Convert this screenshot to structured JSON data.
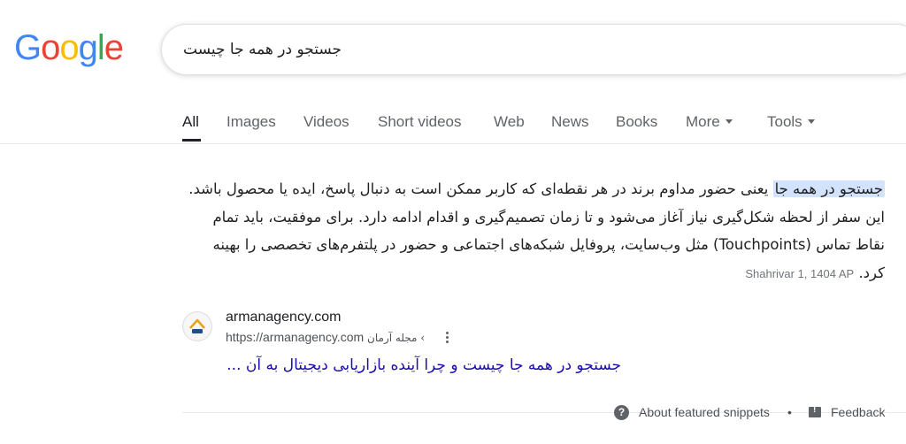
{
  "logo": {
    "letters": [
      "G",
      "o",
      "o",
      "g",
      "l",
      "e"
    ]
  },
  "search": {
    "query": "جستجو در همه جا چیست"
  },
  "tabs": [
    {
      "label": "All",
      "active": true
    },
    {
      "label": "Images"
    },
    {
      "label": "Videos"
    },
    {
      "label": "Short videos"
    },
    {
      "label": "Web"
    },
    {
      "label": "News"
    },
    {
      "label": "Books"
    },
    {
      "label": "More"
    },
    {
      "label": "Tools"
    }
  ],
  "snippet": {
    "highlight": "جستجو در همه جا",
    "text": "یعنی حضور مداوم برند در هر نقطه‌ای که کاربر ممکن است به دنبال پاسخ، ایده یا محصول باشد. این سفر از لحظه شکل‌گیری نیاز آغاز می‌شود و تا زمان تصمیم‌گیری و اقدام ادامه دارد. برای موفقیت، باید تمام نقاط تماس (Touchpoints) مثل وب‌سایت، پروفایل شبکه‌های اجتماعی و حضور در پلتفرم‌های تخصصی را بهینه کرد.",
    "date": "Shahrivar 1, 1404 AP"
  },
  "result": {
    "site_name": "armanagency.com",
    "url": "https://armanagency.com",
    "breadcrumb": "› مجله آرمان",
    "title": "جستجو در همه جا چیست و چرا آینده بازاریابی دیجیتال به آن ...",
    "favicon": "arman-logo-icon"
  },
  "footer": {
    "about": "About featured snippets",
    "separator": "•",
    "feedback": "Feedback"
  },
  "colors": {
    "link": "#1a0dab",
    "highlight": "#d3e3fd"
  }
}
